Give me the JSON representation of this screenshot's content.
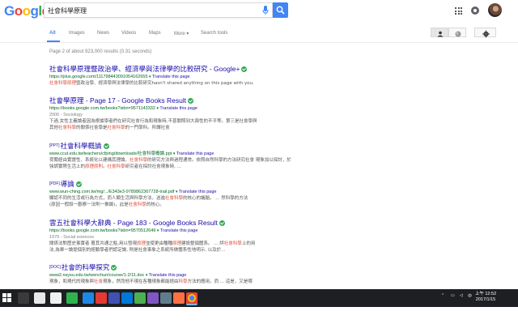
{
  "colors": {
    "brand_blue": "#4285f4",
    "link": "#1a0dab",
    "url_green": "#006621",
    "highlight": "#dd4b39",
    "verified": "#34a853",
    "taskbar": "#1e1f22"
  },
  "header": {
    "logo_letters": [
      "G",
      "o",
      "o",
      "g",
      "l",
      "e"
    ],
    "search_value": "社會科學原理",
    "search_icon": "search-icon",
    "mic_icon": "microphone-icon"
  },
  "nav": {
    "tabs": [
      "All",
      "Images",
      "News",
      "Videos",
      "Maps",
      "More ▾",
      "Search tools"
    ]
  },
  "stats": "Page 2 of about 923,000 results (0.31 seconds)",
  "results": [
    {
      "title": "社會科學原理暨政治學、經濟學與法律學的比較研究 - Google+",
      "url": "https://plus.google.com/111798443091054162655",
      "translate": "Translate this page",
      "snippet_hl": "社會科學原理",
      "snippet_rest": "暨政治學、經濟學與法律學的比較研究hasn't shared anything on this page with you."
    },
    {
      "title": "社會學原理 - Page 17 - Google Books Result",
      "url": "https://books.google.com.tw/books?isbn=9571143332",
      "translate": "Translate this page",
      "meta": "2006 - Sociology",
      "snippet1": "下過,女性主義論者因為根據學者們在研究社會行為和現象時,不甚關照到大兩性的不平等。第三是社會學與",
      "snippet2a": "其他",
      "snippet2hl": "社會科學",
      "snippet2b": "的關係社會學是",
      "snippet2hl2": "社會科學",
      "snippet2c": "的一門學科。所謂社會"
    },
    {
      "fmt": "[PPT]",
      "title": "社會科學概論",
      "url": "www.ccut.edu.tw/teachers/cfping/downloads/社會科學概論.ppt",
      "translate": "Translate this page",
      "snippet1a": "荷蘭經由實證性、系統化以建構其理論。",
      "snippet1hl": "社會科學",
      "snippet1b": "的研究方法與過程通常。依照自然科學的方法研究社會 現象加以探討，於",
      "snippet2a": "強調實際生活上的",
      "snippet2hl": "原理原則",
      "snippet2b": "。",
      "snippet2hl2": "社會科學",
      "snippet2c": "研究者在探討社會現象時, ..."
    },
    {
      "fmt": "[PDF]",
      "title": "導論",
      "url": "www.wun-ching.com.tw/mg/.../E343e3-9789862367728-trail.pdf",
      "translate": "Translate this page",
      "snippet1a": "顯認不同的生活或行為方式，而人類生活與科學方法，送進",
      "snippet1hl": "社會科學",
      "snippet1b": "的核心的議題。 ... 然科學的方法",
      "snippet2a": "(原因一假設一觀察一法則一推論)，此是",
      "snippet2hl": "社會科學",
      "snippet2b": "的核心。"
    },
    {
      "title": "雲五社會科學大辭典 - Page 183 - Google Books Result",
      "url": "https://books.google.com.tw/books?isbn=9570512649",
      "translate": "Translate this page",
      "meta": "1979 - Social sciences",
      "snippet1a": "關係法對歷史事實者 著其共通之點,用以發現",
      "snippet1hl": "原理",
      "snippet1b": "並使更由種種",
      "snippet1hl2": "原理",
      "snippet1c": "建設整個體系。 ... 評",
      "snippet1hl3": "社會科學",
      "snippet1d": "上的用",
      "snippet2": "法,為單一論提個別的經驗學者們認定論, 則是社會事象之系統所做體系性地明示, 以及於..."
    },
    {
      "fmt": "[DOC]",
      "title": "社會的科學探究",
      "url": "www2.nsysu.edu.tw/wenchun/course/1-2/11.doc",
      "translate": "Translate this page",
      "snippet1a": "現象，和現代的現象與",
      "snippet1hl": "社會",
      "snippet1b": "現象，然而他不現在各種現象都能經由",
      "snippet1hl2": "科學",
      "snippet1c": "方法的應用，而 ... 這是，又是哪"
    }
  ],
  "taskbar": {
    "clock_time": "上午 12:52",
    "clock_date": "2017/1/15",
    "tray_lang": "中"
  }
}
